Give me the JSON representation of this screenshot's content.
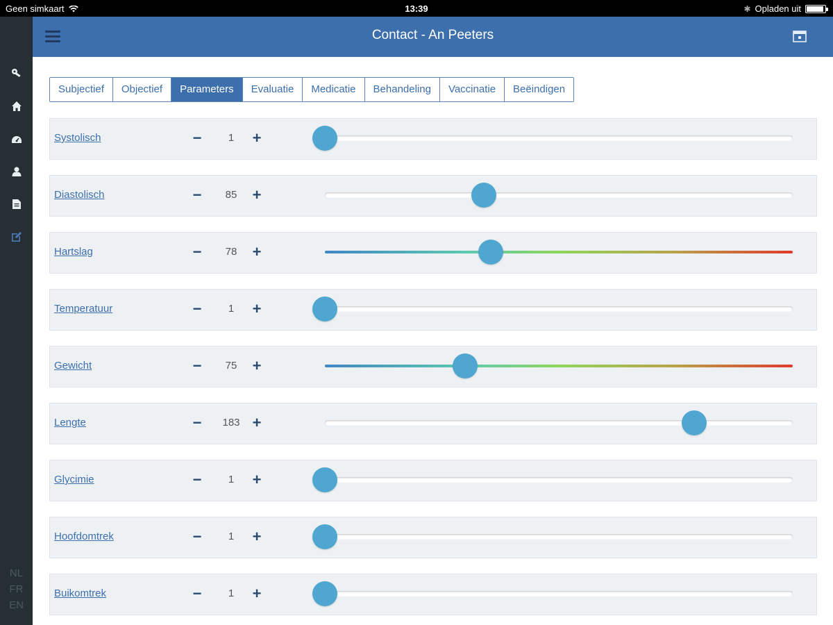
{
  "status_bar": {
    "carrier": "Geen simkaart",
    "time": "13:39",
    "charging": "Opladen uit",
    "icons": [
      "wifi-icon",
      "bluetooth-icon",
      "battery-icon"
    ]
  },
  "sidebar": {
    "items": [
      {
        "name": "key-icon"
      },
      {
        "name": "home-icon"
      },
      {
        "name": "dashboard-icon"
      },
      {
        "name": "user-icon"
      },
      {
        "name": "document-icon"
      },
      {
        "name": "edit-icon",
        "active": true
      }
    ],
    "languages": [
      "NL",
      "FR",
      "EN"
    ]
  },
  "header": {
    "title": "Contact - An Peeters",
    "menu_icon": "hamburger-icon",
    "right_icon": "calendar-icon"
  },
  "tabs": [
    {
      "label": "Subjectief"
    },
    {
      "label": "Objectief"
    },
    {
      "label": "Parameters",
      "active": true
    },
    {
      "label": "Evaluatie"
    },
    {
      "label": "Medicatie"
    },
    {
      "label": "Behandeling"
    },
    {
      "label": "Vaccinatie"
    },
    {
      "label": "Beëindigen"
    }
  ],
  "controls": {
    "minus": "−",
    "plus": "+"
  },
  "parameters": [
    {
      "label": "Systolisch",
      "value": "1",
      "position": 0.0,
      "gradient": false
    },
    {
      "label": "Diastolisch",
      "value": "85",
      "position": 0.34,
      "gradient": false
    },
    {
      "label": "Hartslag",
      "value": "78",
      "position": 0.355,
      "gradient": true
    },
    {
      "label": "Temperatuur",
      "value": "1",
      "position": 0.0,
      "gradient": false
    },
    {
      "label": "Gewicht",
      "value": "75",
      "position": 0.3,
      "gradient": true
    },
    {
      "label": "Lengte",
      "value": "183",
      "position": 0.79,
      "gradient": false
    },
    {
      "label": "Glycimie",
      "value": "1",
      "position": 0.0,
      "gradient": false
    },
    {
      "label": "Hoofdomtrek",
      "value": "1",
      "position": 0.0,
      "gradient": false
    },
    {
      "label": "Buikomtrek",
      "value": "1",
      "position": 0.0,
      "gradient": false
    }
  ],
  "colors": {
    "header": "#3d6fad",
    "sidebar": "#263034",
    "thumb": "#4fa7d1",
    "row_bg": "#edf1f4"
  }
}
